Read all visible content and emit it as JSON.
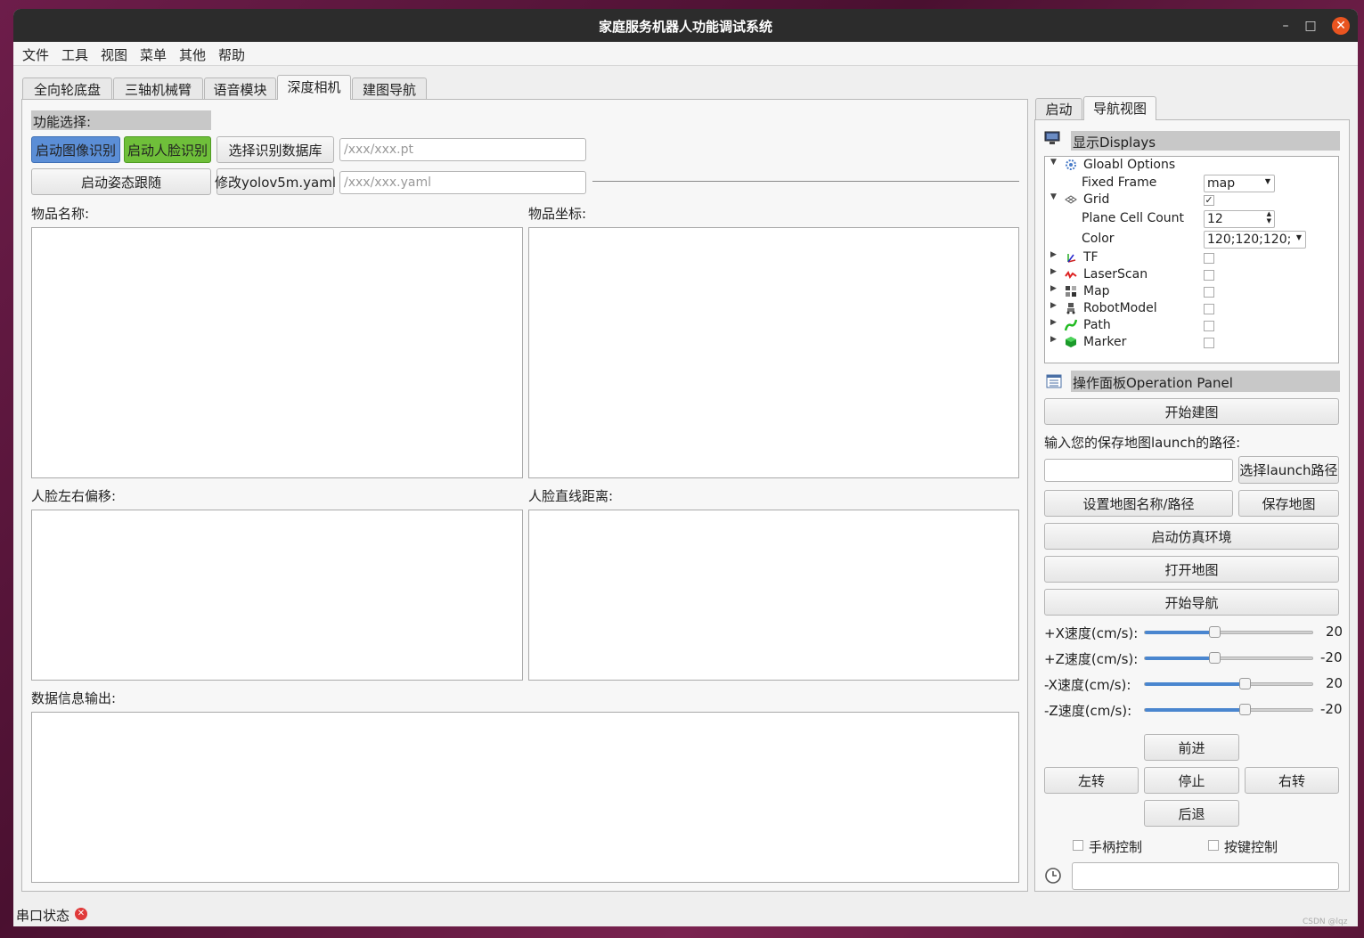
{
  "window": {
    "title": "家庭服务机器人功能调试系统"
  },
  "menu": [
    "文件",
    "工具",
    "视图",
    "菜单",
    "其他",
    "帮助"
  ],
  "main_tabs": [
    "全向轮底盘",
    "三轴机械臂",
    "语音模块",
    "深度相机",
    "建图导航"
  ],
  "function_section": {
    "header": "功能选择:",
    "btn_image_recog": "启动图像识别",
    "btn_face_recog": "启动人脸识别",
    "btn_select_db": "选择识别数据库",
    "pt_placeholder": "/xxx/xxx.pt",
    "btn_pose_follow": "启动姿态跟随",
    "btn_modify_yaml": "修改yolov5m.yaml",
    "yaml_placeholder": "/xxx/xxx.yaml"
  },
  "panels": {
    "item_name": "物品名称:",
    "item_coord": "物品坐标:",
    "face_offset": "人脸左右偏移:",
    "face_distance": "人脸直线距离:",
    "data_output": "数据信息输出:"
  },
  "right_tabs": [
    "启动",
    "导航视图"
  ],
  "displays": {
    "header": "显示Displays",
    "global_options": "Gloabl Options",
    "fixed_frame_label": "Fixed Frame",
    "fixed_frame_value": "map",
    "grid": "Grid",
    "plane_cell_count_label": "Plane Cell Count",
    "plane_cell_count_value": "12",
    "color_label": "Color",
    "color_value": "120;120;120;",
    "items": [
      "TF",
      "LaserScan",
      "Map",
      "RobotModel",
      "Path",
      "Marker"
    ]
  },
  "operation": {
    "header": "操作面板Operation Panel",
    "btn_start_mapping": "开始建图",
    "launch_path_label": "输入您的保存地图launch的路径:",
    "btn_select_launch": "选择launch路径",
    "btn_set_map_name": "设置地图名称/路径",
    "btn_save_map": "保存地图",
    "btn_start_sim": "启动仿真环境",
    "btn_open_map": "打开地图",
    "btn_start_nav": "开始导航",
    "sliders": [
      {
        "label": "+X速度(cm/s):",
        "value": "20",
        "fraction": 0.41
      },
      {
        "label": "+Z速度(cm/s):",
        "value": "-20",
        "fraction": 0.41
      },
      {
        "label": "-X速度(cm/s):",
        "value": "20",
        "fraction": 0.59
      },
      {
        "label": "-Z速度(cm/s):",
        "value": "-20",
        "fraction": 0.59
      }
    ],
    "btn_forward": "前进",
    "btn_left": "左转",
    "btn_stop": "停止",
    "btn_right": "右转",
    "btn_back": "后退",
    "joystick_label": "手柄控制",
    "keyboard_label": "按键控制"
  },
  "statusbar": {
    "serial_status": "串口状态"
  },
  "watermark": "CSDN @lqz"
}
